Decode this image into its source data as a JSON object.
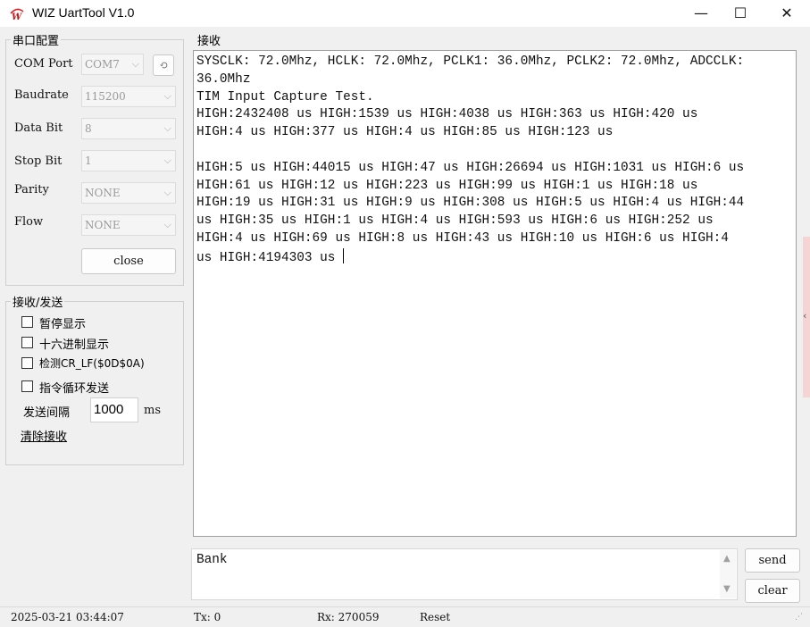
{
  "window": {
    "title": "WIZ UartTool V1.0",
    "minimize_glyph": "—",
    "maximize_glyph": "☐",
    "close_glyph": "✕",
    "logo_icon": "wiz-logo-icon",
    "logo_color": "#e02020"
  },
  "serial_config": {
    "title": "串口配置",
    "fields": [
      {
        "label": "COM Port",
        "value": "COM7"
      },
      {
        "label": "Baudrate",
        "value": "115200"
      },
      {
        "label": "Data Bit",
        "value": "8"
      },
      {
        "label": "Stop Bit",
        "value": "1"
      },
      {
        "label": "Parity",
        "value": "NONE"
      },
      {
        "label": "Flow",
        "value": "NONE"
      }
    ],
    "refresh_icon": "refresh-icon",
    "close_button": "close"
  },
  "rx_tx": {
    "title": "接收/发送",
    "checkboxes": [
      {
        "label": "暂停显示",
        "checked": false
      },
      {
        "label": "十六进制显示",
        "checked": false
      },
      {
        "label": "检测CR_LF($0D$0A)",
        "checked": false
      },
      {
        "label": "指令循环发送",
        "checked": false
      }
    ],
    "interval_label": "发送间隔",
    "interval_value": "1000",
    "interval_unit": "ms",
    "clear_recv_link": "清除接收"
  },
  "receive": {
    "title": "接收",
    "lines": [
      "SYSCLK: 72.0Mhz, HCLK: 72.0Mhz, PCLK1: 36.0Mhz, PCLK2: 72.0Mhz, ADCCLK:",
      "36.0Mhz",
      "TIM Input Capture Test.",
      "HIGH:2432408 us HIGH:1539 us HIGH:4038 us HIGH:363 us HIGH:420 us",
      "HIGH:4 us HIGH:377 us HIGH:4 us HIGH:85 us HIGH:123 us",
      "",
      "HIGH:5 us HIGH:44015 us HIGH:47 us HIGH:26694 us HIGH:1031 us HIGH:6 us",
      "HIGH:61 us HIGH:12 us HIGH:223 us HIGH:99 us HIGH:1 us HIGH:18 us",
      "HIGH:19 us HIGH:31 us HIGH:9 us HIGH:308 us HIGH:5 us HIGH:4 us HIGH:44",
      "us HIGH:35 us HIGH:1 us HIGH:4 us HIGH:593 us HIGH:6 us HIGH:252 us",
      "HIGH:4 us HIGH:69 us HIGH:8 us HIGH:43 us HIGH:10 us HIGH:6 us HIGH:4",
      "us HIGH:4194303 us "
    ]
  },
  "send": {
    "text": "Bank",
    "send_button": "send",
    "clear_button": "clear"
  },
  "status_bar": {
    "datetime": "2025-03-21 03:44:07",
    "tx": "Tx: 0",
    "rx": "Rx: 270059",
    "reset": "Reset"
  },
  "colors": {
    "window_bg": "#f0f0f0",
    "edge_panel": "#f7d4d4"
  }
}
